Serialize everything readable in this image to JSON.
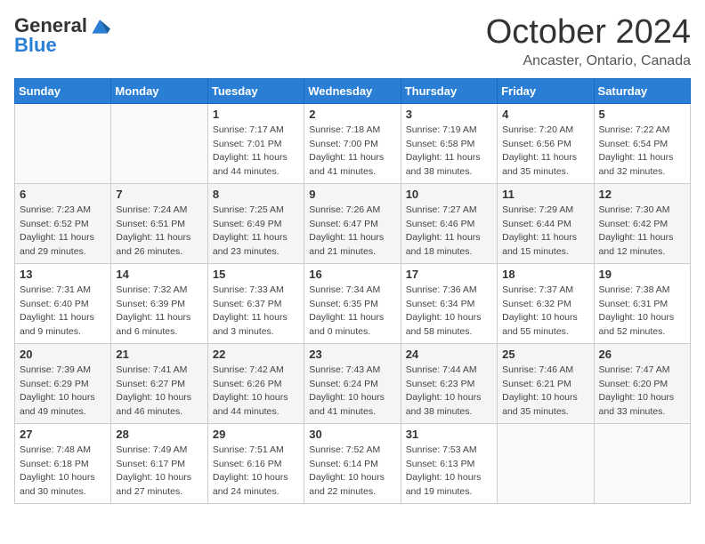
{
  "logo": {
    "general": "General",
    "blue": "Blue"
  },
  "header": {
    "month": "October 2024",
    "location": "Ancaster, Ontario, Canada"
  },
  "weekdays": [
    "Sunday",
    "Monday",
    "Tuesday",
    "Wednesday",
    "Thursday",
    "Friday",
    "Saturday"
  ],
  "weeks": [
    [
      {
        "day": "",
        "sunrise": "",
        "sunset": "",
        "daylight": ""
      },
      {
        "day": "",
        "sunrise": "",
        "sunset": "",
        "daylight": ""
      },
      {
        "day": "1",
        "sunrise": "Sunrise: 7:17 AM",
        "sunset": "Sunset: 7:01 PM",
        "daylight": "Daylight: 11 hours and 44 minutes."
      },
      {
        "day": "2",
        "sunrise": "Sunrise: 7:18 AM",
        "sunset": "Sunset: 7:00 PM",
        "daylight": "Daylight: 11 hours and 41 minutes."
      },
      {
        "day": "3",
        "sunrise": "Sunrise: 7:19 AM",
        "sunset": "Sunset: 6:58 PM",
        "daylight": "Daylight: 11 hours and 38 minutes."
      },
      {
        "day": "4",
        "sunrise": "Sunrise: 7:20 AM",
        "sunset": "Sunset: 6:56 PM",
        "daylight": "Daylight: 11 hours and 35 minutes."
      },
      {
        "day": "5",
        "sunrise": "Sunrise: 7:22 AM",
        "sunset": "Sunset: 6:54 PM",
        "daylight": "Daylight: 11 hours and 32 minutes."
      }
    ],
    [
      {
        "day": "6",
        "sunrise": "Sunrise: 7:23 AM",
        "sunset": "Sunset: 6:52 PM",
        "daylight": "Daylight: 11 hours and 29 minutes."
      },
      {
        "day": "7",
        "sunrise": "Sunrise: 7:24 AM",
        "sunset": "Sunset: 6:51 PM",
        "daylight": "Daylight: 11 hours and 26 minutes."
      },
      {
        "day": "8",
        "sunrise": "Sunrise: 7:25 AM",
        "sunset": "Sunset: 6:49 PM",
        "daylight": "Daylight: 11 hours and 23 minutes."
      },
      {
        "day": "9",
        "sunrise": "Sunrise: 7:26 AM",
        "sunset": "Sunset: 6:47 PM",
        "daylight": "Daylight: 11 hours and 21 minutes."
      },
      {
        "day": "10",
        "sunrise": "Sunrise: 7:27 AM",
        "sunset": "Sunset: 6:46 PM",
        "daylight": "Daylight: 11 hours and 18 minutes."
      },
      {
        "day": "11",
        "sunrise": "Sunrise: 7:29 AM",
        "sunset": "Sunset: 6:44 PM",
        "daylight": "Daylight: 11 hours and 15 minutes."
      },
      {
        "day": "12",
        "sunrise": "Sunrise: 7:30 AM",
        "sunset": "Sunset: 6:42 PM",
        "daylight": "Daylight: 11 hours and 12 minutes."
      }
    ],
    [
      {
        "day": "13",
        "sunrise": "Sunrise: 7:31 AM",
        "sunset": "Sunset: 6:40 PM",
        "daylight": "Daylight: 11 hours and 9 minutes."
      },
      {
        "day": "14",
        "sunrise": "Sunrise: 7:32 AM",
        "sunset": "Sunset: 6:39 PM",
        "daylight": "Daylight: 11 hours and 6 minutes."
      },
      {
        "day": "15",
        "sunrise": "Sunrise: 7:33 AM",
        "sunset": "Sunset: 6:37 PM",
        "daylight": "Daylight: 11 hours and 3 minutes."
      },
      {
        "day": "16",
        "sunrise": "Sunrise: 7:34 AM",
        "sunset": "Sunset: 6:35 PM",
        "daylight": "Daylight: 11 hours and 0 minutes."
      },
      {
        "day": "17",
        "sunrise": "Sunrise: 7:36 AM",
        "sunset": "Sunset: 6:34 PM",
        "daylight": "Daylight: 10 hours and 58 minutes."
      },
      {
        "day": "18",
        "sunrise": "Sunrise: 7:37 AM",
        "sunset": "Sunset: 6:32 PM",
        "daylight": "Daylight: 10 hours and 55 minutes."
      },
      {
        "day": "19",
        "sunrise": "Sunrise: 7:38 AM",
        "sunset": "Sunset: 6:31 PM",
        "daylight": "Daylight: 10 hours and 52 minutes."
      }
    ],
    [
      {
        "day": "20",
        "sunrise": "Sunrise: 7:39 AM",
        "sunset": "Sunset: 6:29 PM",
        "daylight": "Daylight: 10 hours and 49 minutes."
      },
      {
        "day": "21",
        "sunrise": "Sunrise: 7:41 AM",
        "sunset": "Sunset: 6:27 PM",
        "daylight": "Daylight: 10 hours and 46 minutes."
      },
      {
        "day": "22",
        "sunrise": "Sunrise: 7:42 AM",
        "sunset": "Sunset: 6:26 PM",
        "daylight": "Daylight: 10 hours and 44 minutes."
      },
      {
        "day": "23",
        "sunrise": "Sunrise: 7:43 AM",
        "sunset": "Sunset: 6:24 PM",
        "daylight": "Daylight: 10 hours and 41 minutes."
      },
      {
        "day": "24",
        "sunrise": "Sunrise: 7:44 AM",
        "sunset": "Sunset: 6:23 PM",
        "daylight": "Daylight: 10 hours and 38 minutes."
      },
      {
        "day": "25",
        "sunrise": "Sunrise: 7:46 AM",
        "sunset": "Sunset: 6:21 PM",
        "daylight": "Daylight: 10 hours and 35 minutes."
      },
      {
        "day": "26",
        "sunrise": "Sunrise: 7:47 AM",
        "sunset": "Sunset: 6:20 PM",
        "daylight": "Daylight: 10 hours and 33 minutes."
      }
    ],
    [
      {
        "day": "27",
        "sunrise": "Sunrise: 7:48 AM",
        "sunset": "Sunset: 6:18 PM",
        "daylight": "Daylight: 10 hours and 30 minutes."
      },
      {
        "day": "28",
        "sunrise": "Sunrise: 7:49 AM",
        "sunset": "Sunset: 6:17 PM",
        "daylight": "Daylight: 10 hours and 27 minutes."
      },
      {
        "day": "29",
        "sunrise": "Sunrise: 7:51 AM",
        "sunset": "Sunset: 6:16 PM",
        "daylight": "Daylight: 10 hours and 24 minutes."
      },
      {
        "day": "30",
        "sunrise": "Sunrise: 7:52 AM",
        "sunset": "Sunset: 6:14 PM",
        "daylight": "Daylight: 10 hours and 22 minutes."
      },
      {
        "day": "31",
        "sunrise": "Sunrise: 7:53 AM",
        "sunset": "Sunset: 6:13 PM",
        "daylight": "Daylight: 10 hours and 19 minutes."
      },
      {
        "day": "",
        "sunrise": "",
        "sunset": "",
        "daylight": ""
      },
      {
        "day": "",
        "sunrise": "",
        "sunset": "",
        "daylight": ""
      }
    ]
  ]
}
